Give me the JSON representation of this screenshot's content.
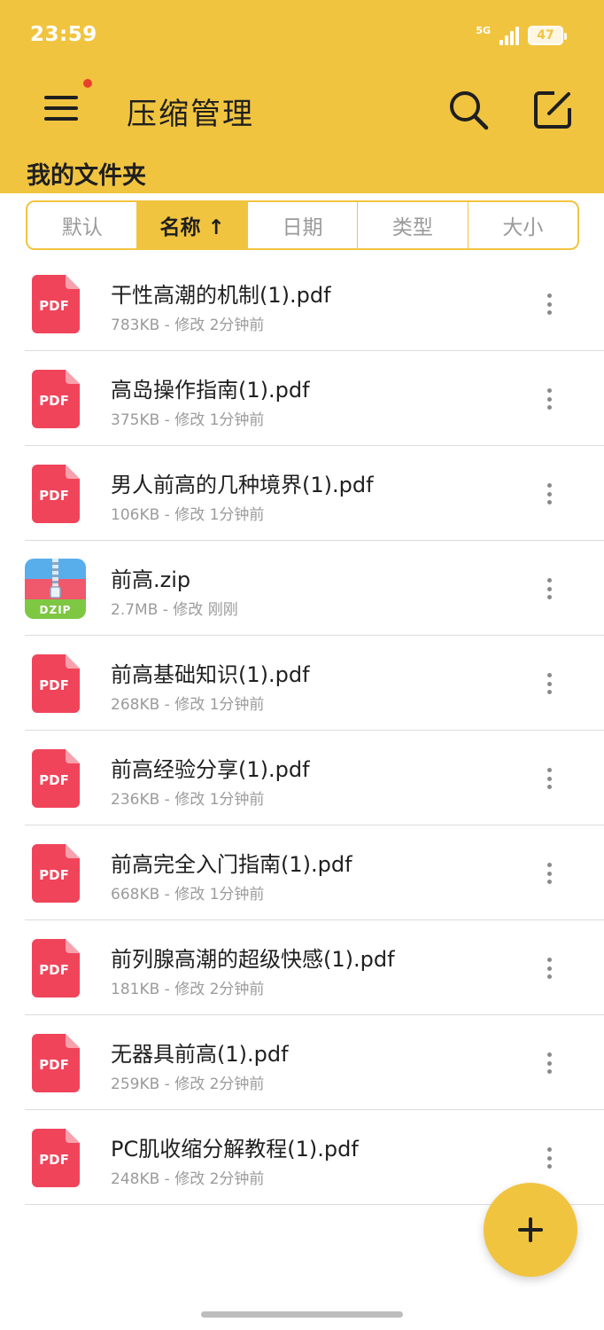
{
  "status_bar": {
    "time": "23:59",
    "network": "5G",
    "battery": "47"
  },
  "app_bar": {
    "title": "压缩管理"
  },
  "section": {
    "title": "我的文件夹"
  },
  "sort_tabs": [
    {
      "label": "默认",
      "active": false
    },
    {
      "label": "名称 ↑",
      "active": true
    },
    {
      "label": "日期",
      "active": false
    },
    {
      "label": "类型",
      "active": false
    },
    {
      "label": "大小",
      "active": false
    }
  ],
  "files": [
    {
      "name": "干性高潮的机制(1).pdf",
      "meta": "783KB - 修改 2分钟前",
      "type": "pdf",
      "icon_label": "PDF"
    },
    {
      "name": "高岛操作指南(1).pdf",
      "meta": "375KB - 修改 1分钟前",
      "type": "pdf",
      "icon_label": "PDF"
    },
    {
      "name": "男人前高的几种境界(1).pdf",
      "meta": "106KB - 修改 1分钟前",
      "type": "pdf",
      "icon_label": "PDF"
    },
    {
      "name": "前高.zip",
      "meta": "2.7MB - 修改 刚刚",
      "type": "zip",
      "icon_label": "DZIP"
    },
    {
      "name": "前高基础知识(1).pdf",
      "meta": "268KB - 修改 1分钟前",
      "type": "pdf",
      "icon_label": "PDF"
    },
    {
      "name": "前高经验分享(1).pdf",
      "meta": "236KB - 修改 1分钟前",
      "type": "pdf",
      "icon_label": "PDF"
    },
    {
      "name": "前高完全入门指南(1).pdf",
      "meta": "668KB - 修改 1分钟前",
      "type": "pdf",
      "icon_label": "PDF"
    },
    {
      "name": "前列腺高潮的超级快感(1).pdf",
      "meta": "181KB - 修改 2分钟前",
      "type": "pdf",
      "icon_label": "PDF"
    },
    {
      "name": "无器具前高(1).pdf",
      "meta": "259KB - 修改 2分钟前",
      "type": "pdf",
      "icon_label": "PDF"
    },
    {
      "name": "PC肌收缩分解教程(1).pdf",
      "meta": "248KB - 修改 2分钟前",
      "type": "pdf",
      "icon_label": "PDF"
    }
  ],
  "colors": {
    "accent": "#F1C440",
    "pdf_red": "#F0445A",
    "notification_dot": "#E8412B"
  },
  "icons": {
    "menu": "menu-icon",
    "search": "search-icon",
    "edit": "edit-icon",
    "more": "more-vertical-icon",
    "add": "plus-icon"
  }
}
